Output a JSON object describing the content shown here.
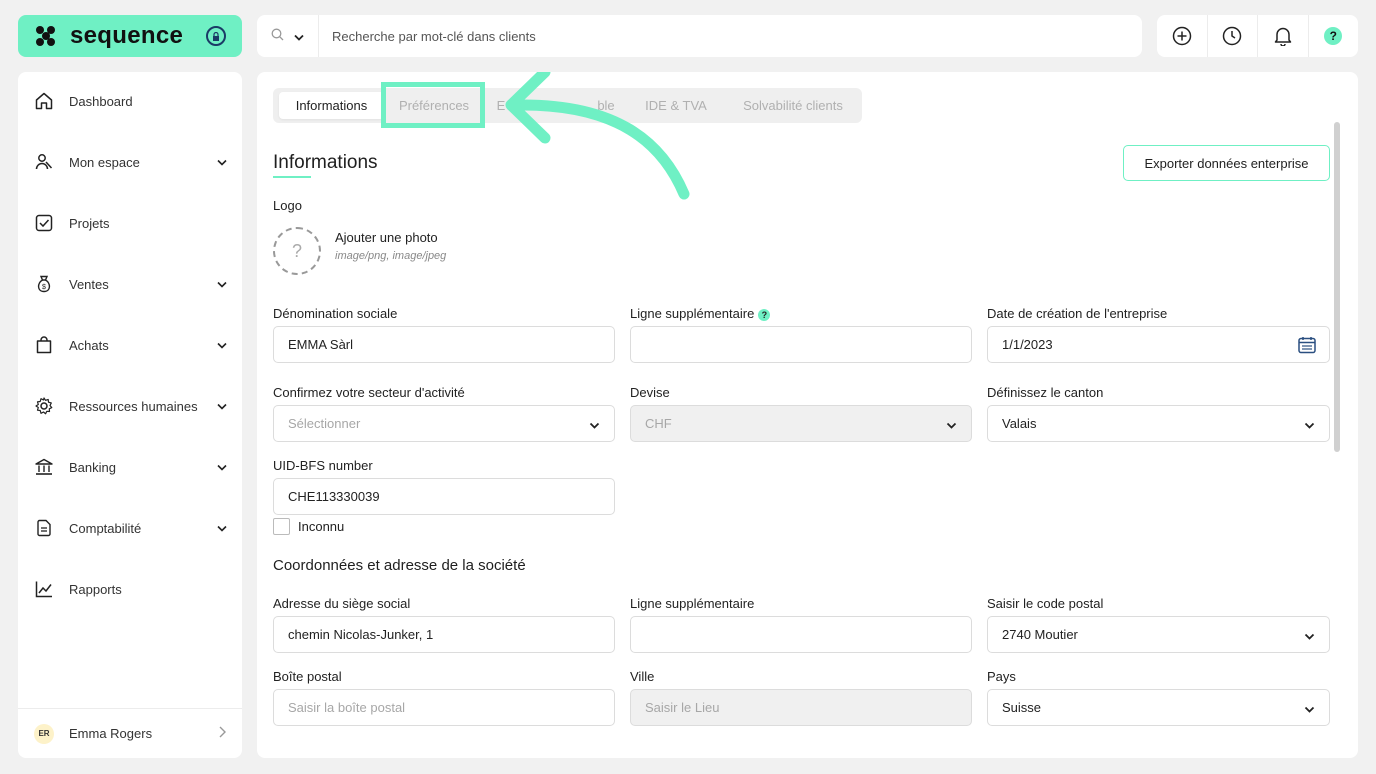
{
  "brand": {
    "name": "sequence"
  },
  "search": {
    "placeholder": "Recherche par mot-clé dans clients"
  },
  "topbar": {
    "help_label": "?"
  },
  "sidebar": {
    "items": [
      {
        "label": "Dashboard",
        "icon": "home-icon",
        "has_chevron": false
      },
      {
        "label": "Mon espace",
        "icon": "people-icon",
        "has_chevron": true
      },
      {
        "label": "Projets",
        "icon": "checkbox-icon",
        "has_chevron": false
      },
      {
        "label": "Ventes",
        "icon": "money-bag-icon",
        "has_chevron": true
      },
      {
        "label": "Achats",
        "icon": "shopping-bag-icon",
        "has_chevron": true
      },
      {
        "label": "Ressources humaines",
        "icon": "gear-icon",
        "has_chevron": true
      },
      {
        "label": "Banking",
        "icon": "bank-icon",
        "has_chevron": true
      },
      {
        "label": "Comptabilité",
        "icon": "document-icon",
        "has_chevron": true
      },
      {
        "label": "Rapports",
        "icon": "chart-icon",
        "has_chevron": false
      }
    ],
    "user": {
      "initials": "ER",
      "name": "Emma Rogers"
    }
  },
  "tabs": [
    {
      "label": "Informations",
      "active": true
    },
    {
      "label": "Préférences",
      "active": false
    },
    {
      "label": "E",
      "active": false
    },
    {
      "label": "ble",
      "active": false
    },
    {
      "label": "IDE & TVA",
      "active": false
    },
    {
      "label": "Solvabilité clients",
      "active": false
    }
  ],
  "main": {
    "title": "Informations",
    "export_label": "Exporter données enterprise",
    "logo_label": "Logo",
    "photo": {
      "title": "Ajouter une photo",
      "subtitle": "image/png, image/jpeg",
      "placeholder": "?"
    },
    "fields": {
      "denomination": {
        "label": "Dénomination sociale",
        "value": "EMMA Sàrl"
      },
      "ligne_supp_1": {
        "label": "Ligne supplémentaire",
        "value": ""
      },
      "date_creation": {
        "label": "Date de création de l'entreprise",
        "value": "1/1/2023"
      },
      "secteur": {
        "label": "Confirmez votre secteur d'activité",
        "placeholder": "Sélectionner"
      },
      "devise": {
        "label": "Devise",
        "value": "CHF"
      },
      "canton": {
        "label": "Définissez le canton",
        "value": "Valais"
      },
      "uid": {
        "label": "UID-BFS number",
        "value": "CHE113330039"
      },
      "inconnu": {
        "label": "Inconnu"
      }
    },
    "address_title": "Coordonnées et adresse de la société",
    "address": {
      "siege": {
        "label": "Adresse du siège social",
        "value": "chemin Nicolas-Junker, 1"
      },
      "ligne_supp_2": {
        "label": "Ligne supplémentaire",
        "value": ""
      },
      "code_postal": {
        "label": "Saisir le code postal",
        "value": "2740 Moutier"
      },
      "boite": {
        "label": "Boîte postal",
        "placeholder": "Saisir la boîte postal"
      },
      "ville": {
        "label": "Ville",
        "placeholder": "Saisir le Lieu"
      },
      "pays": {
        "label": "Pays",
        "value": "Suisse"
      }
    }
  },
  "colors": {
    "accent": "#6ff0c4",
    "text": "#1f1f1f",
    "muted": "#a7a7a7"
  }
}
